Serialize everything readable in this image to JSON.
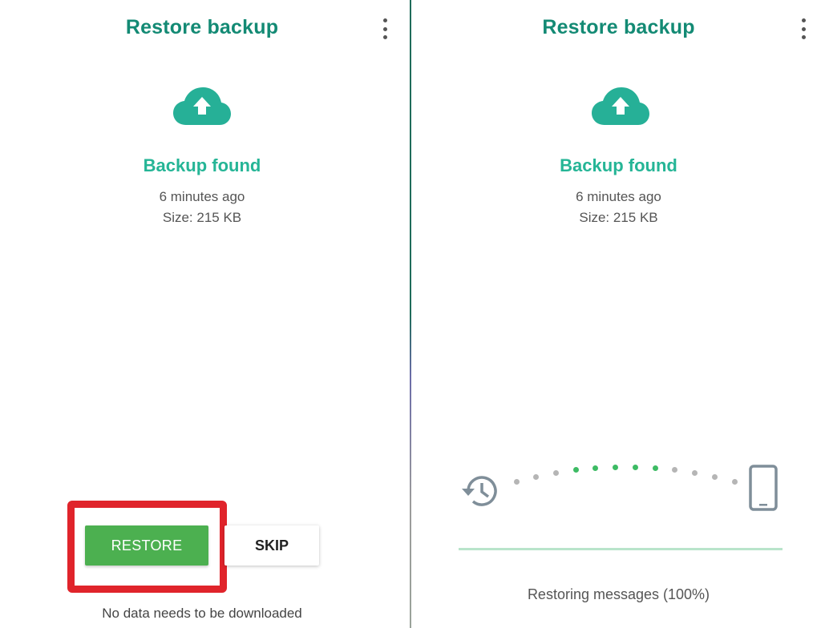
{
  "left_screen": {
    "title": "Restore backup",
    "menu_icon": "more-vert-icon",
    "status_icon": "cloud-upload-icon",
    "status_heading": "Backup found",
    "backup_age": "6 minutes ago",
    "backup_size": "Size: 215 KB",
    "buttons": {
      "restore": "RESTORE",
      "skip": "SKIP"
    },
    "footer_note": "No data needs to be downloaded",
    "highlight_color": "#e0242b"
  },
  "right_screen": {
    "title": "Restore backup",
    "menu_icon": "more-vert-icon",
    "status_icon": "cloud-upload-icon",
    "status_heading": "Backup found",
    "backup_age": "6 minutes ago",
    "backup_size": "Size: 215 KB",
    "transfer_animation": {
      "source_icon": "history-icon",
      "target_icon": "smartphone-icon",
      "dot_count": 12,
      "active_dots": [
        3,
        4,
        5,
        6,
        7
      ]
    },
    "progress": {
      "percent": 100
    },
    "status_text": "Restoring messages (100%)"
  },
  "colors": {
    "title": "#138a74",
    "accent": "#25b596",
    "restore_button": "#4cb050",
    "dot_active": "#3dbb64",
    "dot_inactive": "#b5b5b5",
    "icon_gray": "#7f8e99"
  }
}
